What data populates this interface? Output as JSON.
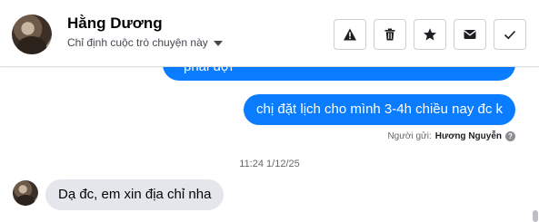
{
  "header": {
    "contact_name": "Hằng Dương",
    "assign_label": "Chỉ định cuộc trò chuyện này",
    "actions": [
      {
        "name": "report-button",
        "icon": "warning-icon"
      },
      {
        "name": "delete-button",
        "icon": "trash-icon"
      },
      {
        "name": "star-button",
        "icon": "star-icon"
      },
      {
        "name": "mark-unread-button",
        "icon": "envelope-icon"
      },
      {
        "name": "mark-done-button",
        "icon": "check-icon"
      }
    ]
  },
  "messages": {
    "outgoing_partial": "phải đợi",
    "outgoing": "chị đặt lịch cho mình 3-4h chiều nay đc k",
    "sender_label": "Người gửi:",
    "sender_name": "Hương Nguyễn",
    "timestamp": "11:24 1/12/25",
    "incoming": "Dạ đc, em xin địa chỉ nha"
  },
  "colors": {
    "outgoing_bubble": "#0a7cff",
    "incoming_bubble": "#e4e6eb"
  }
}
